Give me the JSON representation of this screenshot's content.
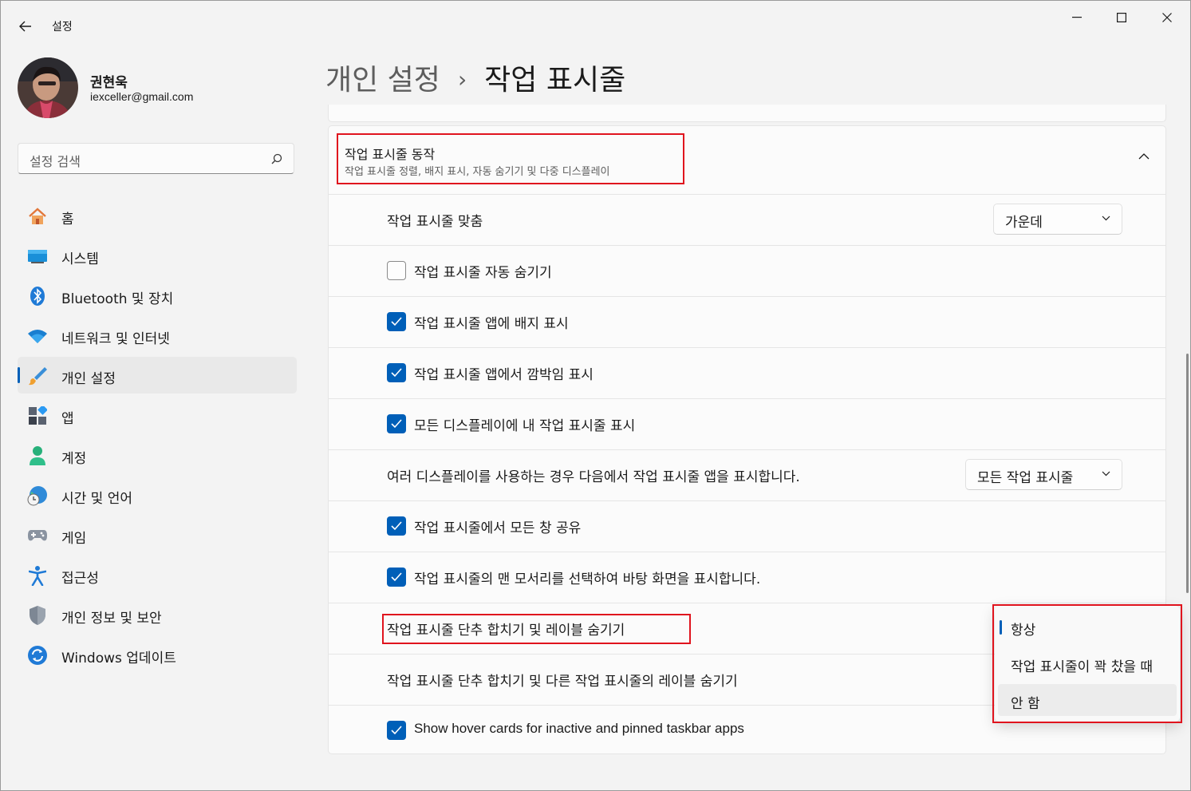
{
  "window": {
    "title": "설정"
  },
  "profile": {
    "name": "권현욱",
    "email": "iexceller@gmail.com"
  },
  "search": {
    "placeholder": "설정 검색"
  },
  "sidebar": {
    "items": [
      {
        "label": "홈",
        "icon": "home-icon"
      },
      {
        "label": "시스템",
        "icon": "system-icon"
      },
      {
        "label": "Bluetooth 및 장치",
        "icon": "bluetooth-icon"
      },
      {
        "label": "네트워크 및 인터넷",
        "icon": "wifi-icon"
      },
      {
        "label": "개인 설정",
        "icon": "brush-icon",
        "selected": true
      },
      {
        "label": "앱",
        "icon": "apps-icon"
      },
      {
        "label": "계정",
        "icon": "account-icon"
      },
      {
        "label": "시간 및 언어",
        "icon": "globe-clock-icon"
      },
      {
        "label": "게임",
        "icon": "gamepad-icon"
      },
      {
        "label": "접근성",
        "icon": "accessibility-icon"
      },
      {
        "label": "개인 정보 및 보안",
        "icon": "shield-icon"
      },
      {
        "label": "Windows 업데이트",
        "icon": "update-icon"
      }
    ]
  },
  "header": {
    "parent": "개인 설정",
    "separator": "›",
    "current": "작업 표시줄"
  },
  "section": {
    "title": "작업 표시줄 동작",
    "subtitle": "작업 표시줄 정렬, 배지 표시, 자동 숨기기 및 다중 디스플레이",
    "expanded": true
  },
  "settings": {
    "alignment": {
      "label": "작업 표시줄 맞춤",
      "value": "가운데"
    },
    "auto_hide": {
      "label": "작업 표시줄 자동 숨기기",
      "checked": false
    },
    "badges": {
      "label": "작업 표시줄 앱에 배지 표시",
      "checked": true
    },
    "flashing": {
      "label": "작업 표시줄 앱에서 깜박임 표시",
      "checked": true
    },
    "all_displays": {
      "label": "모든 디스플레이에 내 작업 표시줄 표시",
      "checked": true
    },
    "multi_display": {
      "label": "여러 디스플레이를 사용하는 경우 다음에서 작업 표시줄 앱을 표시합니다.",
      "value": "모든 작업 표시줄"
    },
    "share_windows": {
      "label": "작업 표시줄에서 모든 창 공유",
      "checked": true
    },
    "far_corner": {
      "label": "작업 표시줄의 맨 모서리를 선택하여 바탕 화면을 표시합니다.",
      "checked": true
    },
    "combine": {
      "label": "작업 표시줄 단추 합치기 및 레이블 숨기기"
    },
    "combine_other": {
      "label": "작업 표시줄 단추 합치기 및 다른 작업 표시줄의 레이블 숨기기"
    },
    "hover_cards": {
      "label": "Show hover cards for inactive and pinned taskbar apps",
      "checked": true
    }
  },
  "flyout": {
    "options": [
      "항상",
      "작업 표시줄이 꽉 찼을 때",
      "안 함"
    ],
    "selected": "항상",
    "hovered": "안 함"
  },
  "colors": {
    "accent": "#005fb8",
    "highlight": "#e0141e"
  }
}
